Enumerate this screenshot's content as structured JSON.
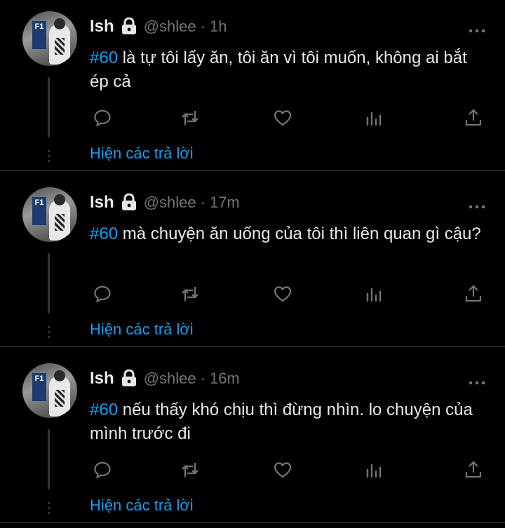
{
  "tweets": [
    {
      "name": "Ish",
      "handle": "@shlee",
      "separator": "·",
      "time": "1h",
      "hashtag": "#60",
      "text": " là tự tôi lấy ăn, tôi ăn vì tôi muốn, không ai bắt ép cả",
      "show_replies": "Hiện các trả lời"
    },
    {
      "name": "Ish",
      "handle": "@shlee",
      "separator": "·",
      "time": "17m",
      "hashtag": "#60",
      "text": " mà chuyện ăn uống của tôi thì liên quan gì cậu?",
      "show_replies": "Hiện các trả lời"
    },
    {
      "name": "Ish",
      "handle": "@shlee",
      "separator": "·",
      "time": "16m",
      "hashtag": "#60",
      "text": " nếu thấy khó chịu thì đừng nhìn. lo chuyện của mình trước đi",
      "show_replies": "Hiện các trả lời"
    }
  ],
  "avatar_sign": "F1",
  "icons": [
    "lock-icon",
    "more-icon",
    "reply-icon",
    "retweet-icon",
    "like-icon",
    "views-icon",
    "share-icon"
  ],
  "colors": {
    "background": "#000000",
    "text": "#e7e9ea",
    "muted": "#71767b",
    "accent": "#1d9bf0",
    "divider": "#2f3336"
  }
}
